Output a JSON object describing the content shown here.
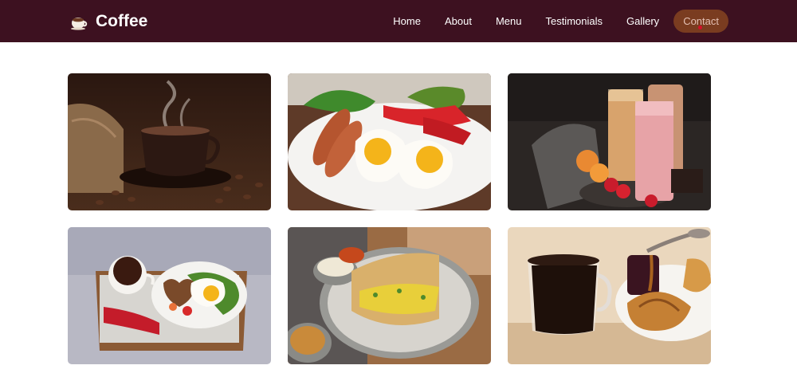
{
  "header": {
    "brand": "Coffee",
    "brand_icon": "coffee-cup-icon"
  },
  "nav": {
    "items": [
      {
        "label": "Home"
      },
      {
        "label": "About"
      },
      {
        "label": "Menu"
      },
      {
        "label": "Testimonials"
      },
      {
        "label": "Gallery"
      },
      {
        "label": "Contact",
        "active": true
      }
    ]
  },
  "gallery": {
    "items": [
      {
        "name": "coffee-cup-beans-photo"
      },
      {
        "name": "sausage-fried-eggs-photo"
      },
      {
        "name": "fruit-smoothies-photo"
      },
      {
        "name": "breakfast-tray-coffee-egg-photo"
      },
      {
        "name": "quesadilla-plate-photo"
      },
      {
        "name": "coffee-mug-croissant-photo"
      }
    ]
  },
  "colors": {
    "navbar": "#3d1120",
    "active_pill": "#7a3c20",
    "active_text": "#e4c0b4"
  }
}
